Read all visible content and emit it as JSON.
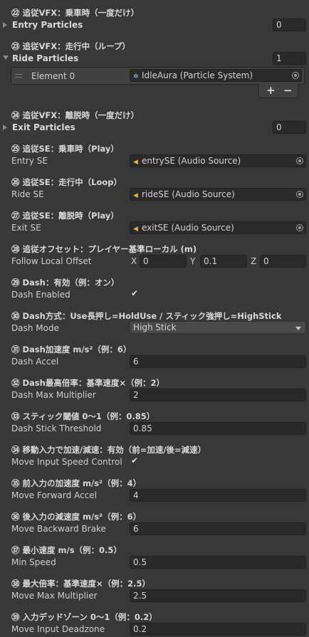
{
  "s22": {
    "header": "㉒ 追従VFX：乗車時（一度だけ）",
    "label": "Entry Particles",
    "size": "0"
  },
  "s23": {
    "header": "㉓ 追従VFX：走行中（ループ）",
    "label": "Ride Particles",
    "size": "1",
    "element_label": "Element 0",
    "element_value": "IdleAura (Particle System)",
    "add_label": "+",
    "remove_label": "−"
  },
  "s24": {
    "header": "㉔ 追従VFX：離脱時（一度だけ）",
    "label": "Exit Particles",
    "size": "0"
  },
  "s25": {
    "header": "㉕ 追従SE：乗車時（Play）",
    "label": "Entry SE",
    "value": "entrySE (Audio Source)"
  },
  "s26": {
    "header": "㉖ 追従SE：走行中（Loop）",
    "label": "Ride SE",
    "value": "rideSE (Audio Source)"
  },
  "s27": {
    "header": "㉗ 追従SE：離脱時（Play）",
    "label": "Exit SE",
    "value": "exitSE (Audio Source)"
  },
  "s28": {
    "header": "㉘ 追従オフセット：プレイヤー基準ローカル (m)",
    "label": "Follow Local Offset",
    "x_label": "X",
    "x": "0",
    "y_label": "Y",
    "y": "0.1",
    "z_label": "Z",
    "z": "0"
  },
  "s29": {
    "header": "㉙ Dash：有効（例：オン）",
    "label": "Dash Enabled",
    "checked": "✔"
  },
  "s30": {
    "header": "㉚ Dash方式：Use長押し=HoldUse / スティック強押し=HighStick",
    "label": "Dash Mode",
    "value": "High Stick"
  },
  "s31": {
    "header": "㉛ Dash加速度 m/s²（例：6）",
    "label": "Dash Accel",
    "value": "6"
  },
  "s32": {
    "header": "㉜ Dash最高倍率：基準速度×（例：2）",
    "label": "Dash Max Multiplier",
    "value": "2"
  },
  "s33": {
    "header": "㉝ スティック閾値 0〜1（例：0.85）",
    "label": "Dash Stick Threshold",
    "value": "0.85"
  },
  "s34": {
    "header": "㉞ 移動入力で加速/減速：有効（前=加速/後=減速）",
    "label": "Move Input Speed Control",
    "checked": "✔"
  },
  "s35": {
    "header": "㉟ 前入力の加速度 m/s²（例：4）",
    "label": "Move Forward Accel",
    "value": "4"
  },
  "s36": {
    "header": "㊱ 後入力の減速度 m/s²（例：6）",
    "label": "Move Backward Brake",
    "value": "6"
  },
  "s37": {
    "header": "㊲ 最小速度 m/s（例：0.5）",
    "label": "Min Speed",
    "value": "0.5"
  },
  "s38": {
    "header": "㊳ 最大倍率：基準速度×（例：2.5）",
    "label": "Move Max Multiplier",
    "value": "2.5"
  },
  "s39": {
    "header": "㊴ 入力デッドゾーン 0〜1（例：0.2）",
    "label": "Move Input Deadzone",
    "value": "0.2"
  },
  "icons": {
    "particle": "particle-system-icon",
    "audio": "audio-source-icon",
    "picker": "object-picker-icon"
  }
}
